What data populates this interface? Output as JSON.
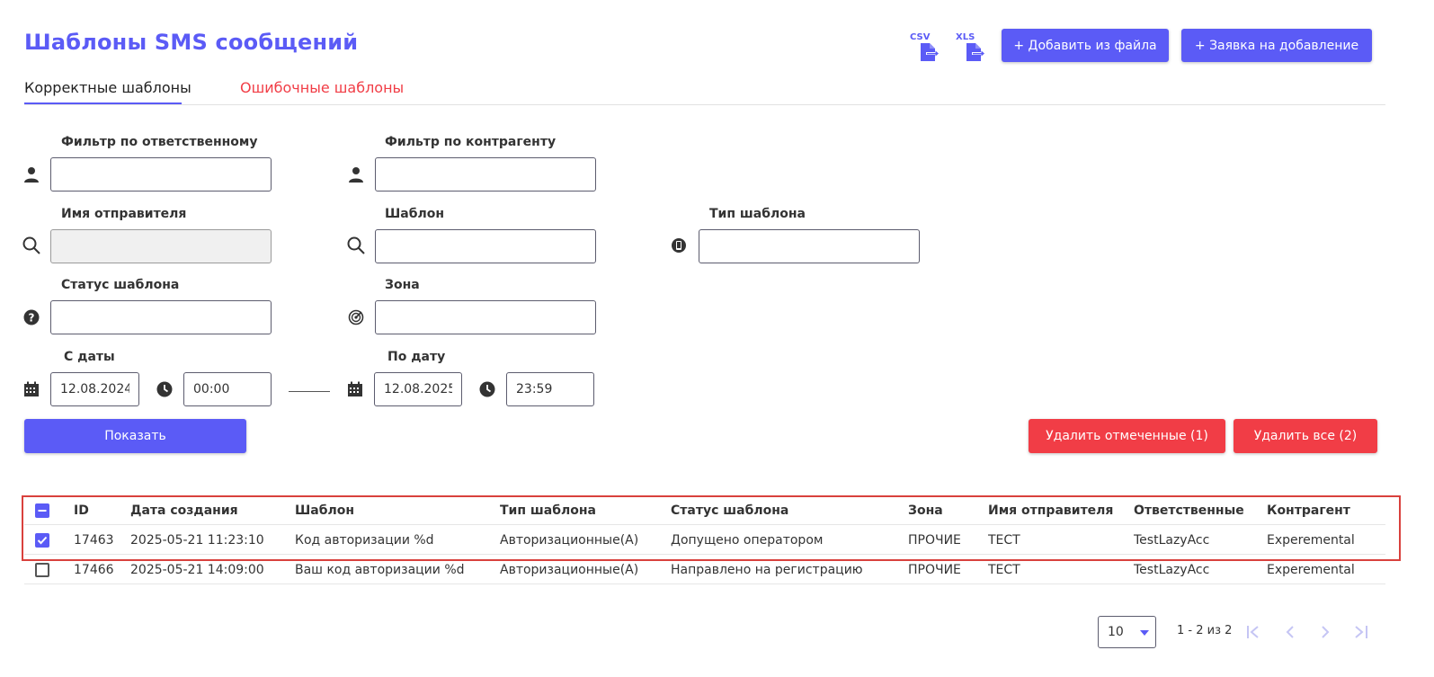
{
  "page": {
    "title": "Шаблоны SMS сообщений"
  },
  "header": {
    "csv_label": "CSV",
    "xls_label": "XLS",
    "add_from_file": "+ Добавить из файла",
    "request_add": "+ Заявка на добавление"
  },
  "tabs": [
    {
      "label": "Корректные шаблоны",
      "active": true
    },
    {
      "label": "Ошибочные шаблоны",
      "active": false
    }
  ],
  "filters": {
    "responsible": {
      "label": "Фильтр по ответственному",
      "value": ""
    },
    "counterparty": {
      "label": "Фильтр по контрагенту",
      "value": ""
    },
    "sender": {
      "label": "Имя отправителя",
      "value": ""
    },
    "template": {
      "label": "Шаблон",
      "value": ""
    },
    "template_type": {
      "label": "Тип шаблона",
      "value": ""
    },
    "template_status": {
      "label": "Статус шаблона",
      "value": ""
    },
    "zone": {
      "label": "Зона",
      "value": ""
    },
    "from_date": {
      "label": "С даты",
      "date": "12.08.2024",
      "time": "00:00"
    },
    "to_date": {
      "label": "По дату",
      "date": "12.08.2025",
      "time": "23:59"
    }
  },
  "actions": {
    "show": "Показать",
    "delete_checked": "Удалить отмеченные (1)",
    "delete_all": "Удалить все (2)"
  },
  "table": {
    "columns": [
      "ID",
      "Дата создания",
      "Шаблон",
      "Тип шаблона",
      "Статус шаблона",
      "Зона",
      "Имя отправителя",
      "Ответственные",
      "Контрагент"
    ],
    "rows": [
      {
        "checked": true,
        "cells": [
          "17463",
          "2025-05-21 11:23:10",
          "Код авторизации %d",
          "Авторизационные(А)",
          "Допущено оператором",
          "ПРОЧИЕ",
          "ТЕСТ",
          "TestLazyAcc",
          "Experemental"
        ]
      },
      {
        "checked": false,
        "cells": [
          "17466",
          "2025-05-21 14:09:00",
          "Ваш код авторизации %d",
          "Авторизационные(А)",
          "Направлено на регистрацию",
          "ПРОЧИЕ",
          "ТЕСТ",
          "TestLazyAcc",
          "Experemental"
        ]
      }
    ]
  },
  "pagination": {
    "page_size": "10",
    "range": "1 - 2 из 2"
  },
  "colors": {
    "accent": "#5b5bf6",
    "danger": "#f13d46",
    "highlight": "#d9413d"
  }
}
